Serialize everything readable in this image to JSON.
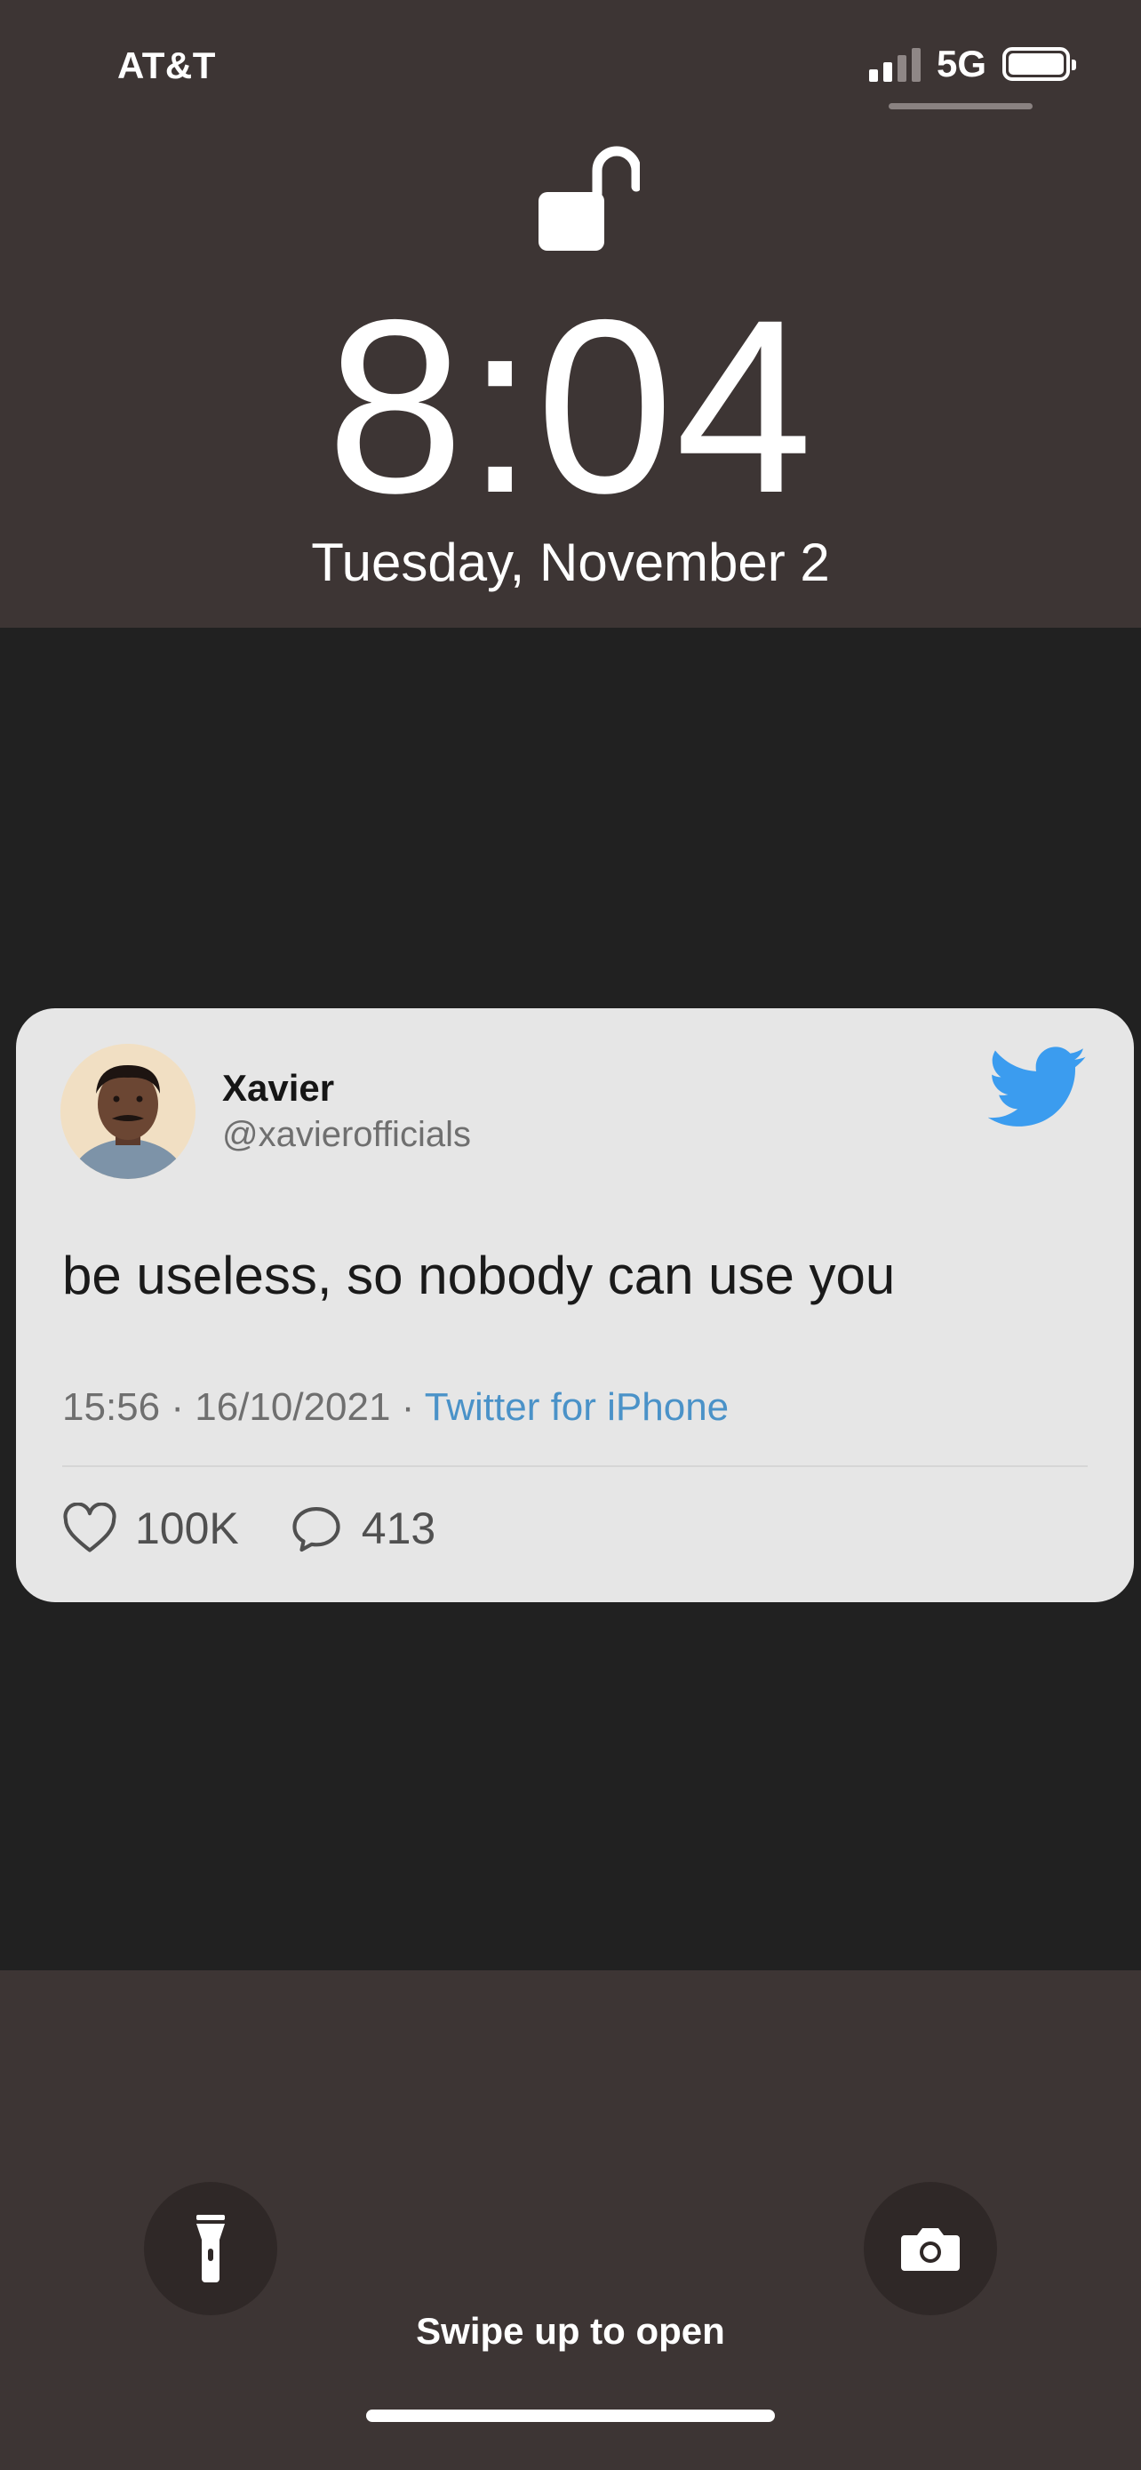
{
  "status_bar": {
    "carrier": "AT&T",
    "network": "5G",
    "signal_bars": 2,
    "signal_bars_total": 4,
    "battery_icon": "battery-full-icon"
  },
  "lock_screen": {
    "lock_icon": "unlocked-padlock-icon",
    "time": "8:04",
    "date": "Tuesday, November 2",
    "swipe_hint": "Swipe up to open",
    "flashlight_icon": "flashlight-icon",
    "camera_icon": "camera-icon"
  },
  "tweet": {
    "author_name": "Xavier",
    "handle": "@xavierofficials",
    "text": "be useless, so nobody can use you",
    "time": "15:56",
    "date": "16/10/2021",
    "separator": "·",
    "source": "Twitter for iPhone",
    "likes": "100K",
    "replies": "413",
    "source_color": "#4a92c8",
    "brand_icon": "twitter-bird-icon",
    "brand_color": "#3b9cef"
  }
}
